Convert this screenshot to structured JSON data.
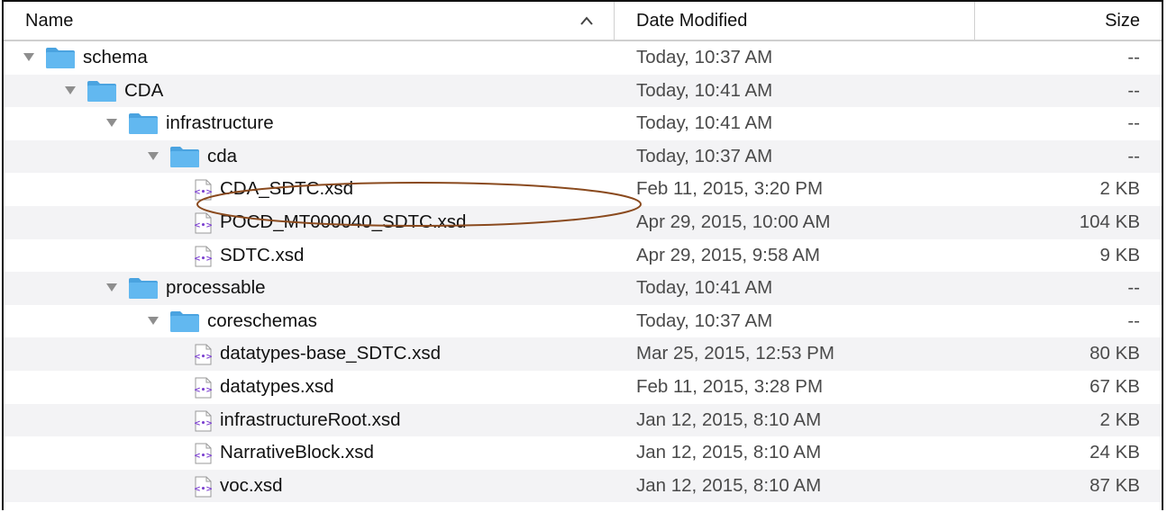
{
  "columns": {
    "name": "Name",
    "date": "Date Modified",
    "size": "Size"
  },
  "colors": {
    "folder": "#62b8f0",
    "folder_dark": "#4aa3e0",
    "file_accent": "#7b3fd0",
    "annotation": "#8a4a1e"
  },
  "rows": [
    {
      "type": "folder",
      "level": 0,
      "expanded": true,
      "name": "schema",
      "date": "Today, 10:37 AM",
      "size": "--"
    },
    {
      "type": "folder",
      "level": 1,
      "expanded": true,
      "name": "CDA",
      "date": "Today, 10:41 AM",
      "size": "--"
    },
    {
      "type": "folder",
      "level": 2,
      "expanded": true,
      "name": "infrastructure",
      "date": "Today, 10:41 AM",
      "size": "--"
    },
    {
      "type": "folder",
      "level": 3,
      "expanded": true,
      "name": "cda",
      "date": "Today, 10:37 AM",
      "size": "--"
    },
    {
      "type": "file",
      "level": 4,
      "name": "CDA_SDTC.xsd",
      "date": "Feb 11, 2015, 3:20 PM",
      "size": "2 KB"
    },
    {
      "type": "file",
      "level": 4,
      "name": "POCD_MT000040_SDTC.xsd",
      "date": "Apr 29, 2015, 10:00 AM",
      "size": "104 KB"
    },
    {
      "type": "file",
      "level": 4,
      "name": "SDTC.xsd",
      "date": "Apr 29, 2015, 9:58 AM",
      "size": "9 KB"
    },
    {
      "type": "folder",
      "level": 2,
      "expanded": true,
      "name": "processable",
      "date": "Today, 10:41 AM",
      "size": "--"
    },
    {
      "type": "folder",
      "level": 3,
      "expanded": true,
      "name": "coreschemas",
      "date": "Today, 10:37 AM",
      "size": "--"
    },
    {
      "type": "file",
      "level": 4,
      "name": "datatypes-base_SDTC.xsd",
      "date": "Mar 25, 2015, 12:53 PM",
      "size": "80 KB"
    },
    {
      "type": "file",
      "level": 4,
      "name": "datatypes.xsd",
      "date": "Feb 11, 2015, 3:28 PM",
      "size": "67 KB"
    },
    {
      "type": "file",
      "level": 4,
      "name": "infrastructureRoot.xsd",
      "date": "Jan 12, 2015, 8:10 AM",
      "size": "2 KB"
    },
    {
      "type": "file",
      "level": 4,
      "name": "NarrativeBlock.xsd",
      "date": "Jan 12, 2015, 8:10 AM",
      "size": "24 KB"
    },
    {
      "type": "file",
      "level": 4,
      "name": "voc.xsd",
      "date": "Jan 12, 2015, 8:10 AM",
      "size": "87 KB"
    }
  ]
}
